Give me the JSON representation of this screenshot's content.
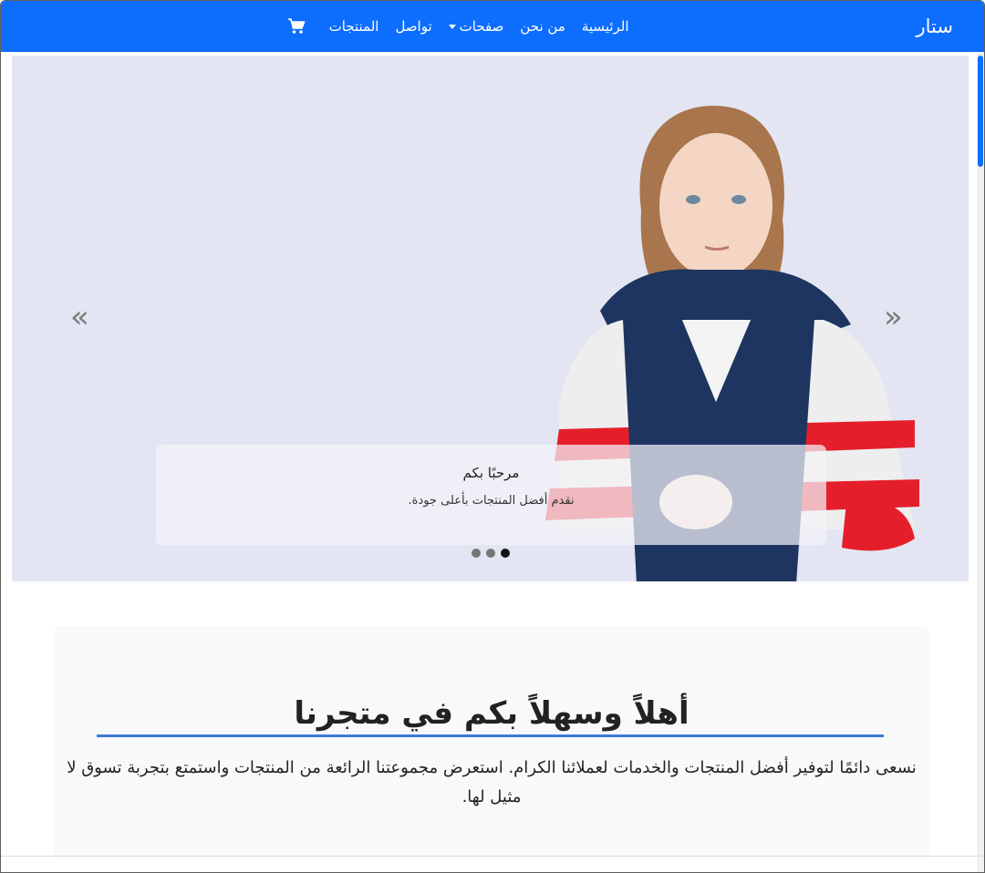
{
  "navbar": {
    "brand": "ستار",
    "links": [
      "الرئيسية",
      "من نحن",
      "صفحات",
      "تواصل",
      "المنتجات"
    ],
    "cart_icon": "cart-icon",
    "color": "#0d6efd"
  },
  "carousel": {
    "prev_icon": "«",
    "next_icon": "»",
    "caption_title": "مرحبًا بكم",
    "caption_text": "نقدم أفضل المنتجات بأعلى جودة.",
    "slides_count": 3,
    "active_slide": 1
  },
  "welcome": {
    "title": "أهلاً وسهلاً بكم في متجرنا",
    "text": "نسعى دائمًا لتوفير أفضل المنتجات والخدمات لعملائنا الكرام. استعرض مجموعتنا الرائعة من المنتجات واستمتع بتجربة تسوق لا مثيل لها."
  }
}
